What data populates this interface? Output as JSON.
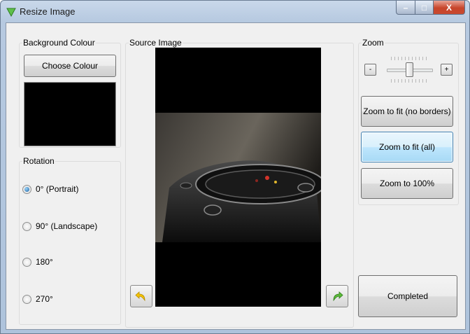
{
  "window": {
    "title": "Resize Image",
    "min_glyph": "–",
    "max_glyph": "□",
    "close_glyph": "X"
  },
  "background_colour": {
    "group_label": "Background Colour",
    "choose_button": "Choose Colour",
    "swatch_color": "#000000"
  },
  "rotation": {
    "group_label": "Rotation",
    "options": [
      {
        "label": "0° (Portrait)",
        "selected": true
      },
      {
        "label": "90° (Landscape)",
        "selected": false
      },
      {
        "label": "180°",
        "selected": false
      },
      {
        "label": "270°",
        "selected": false
      }
    ]
  },
  "source_image": {
    "group_label": "Source Image",
    "rotate_left_icon": "rotate-left-icon",
    "rotate_right_icon": "rotate-right-icon"
  },
  "zoom": {
    "group_label": "Zoom",
    "minus_label": "-",
    "plus_label": "+",
    "slider_level": 0.5,
    "fit_no_borders": "Zoom to fit (no borders)",
    "fit_all": "Zoom to fit (all)",
    "hundred": "Zoom to 100%"
  },
  "completed_button": "Completed",
  "colors": {
    "accent": "#3c7fb1",
    "title_bar": "#b6c9e0",
    "close": "#c7442a"
  }
}
